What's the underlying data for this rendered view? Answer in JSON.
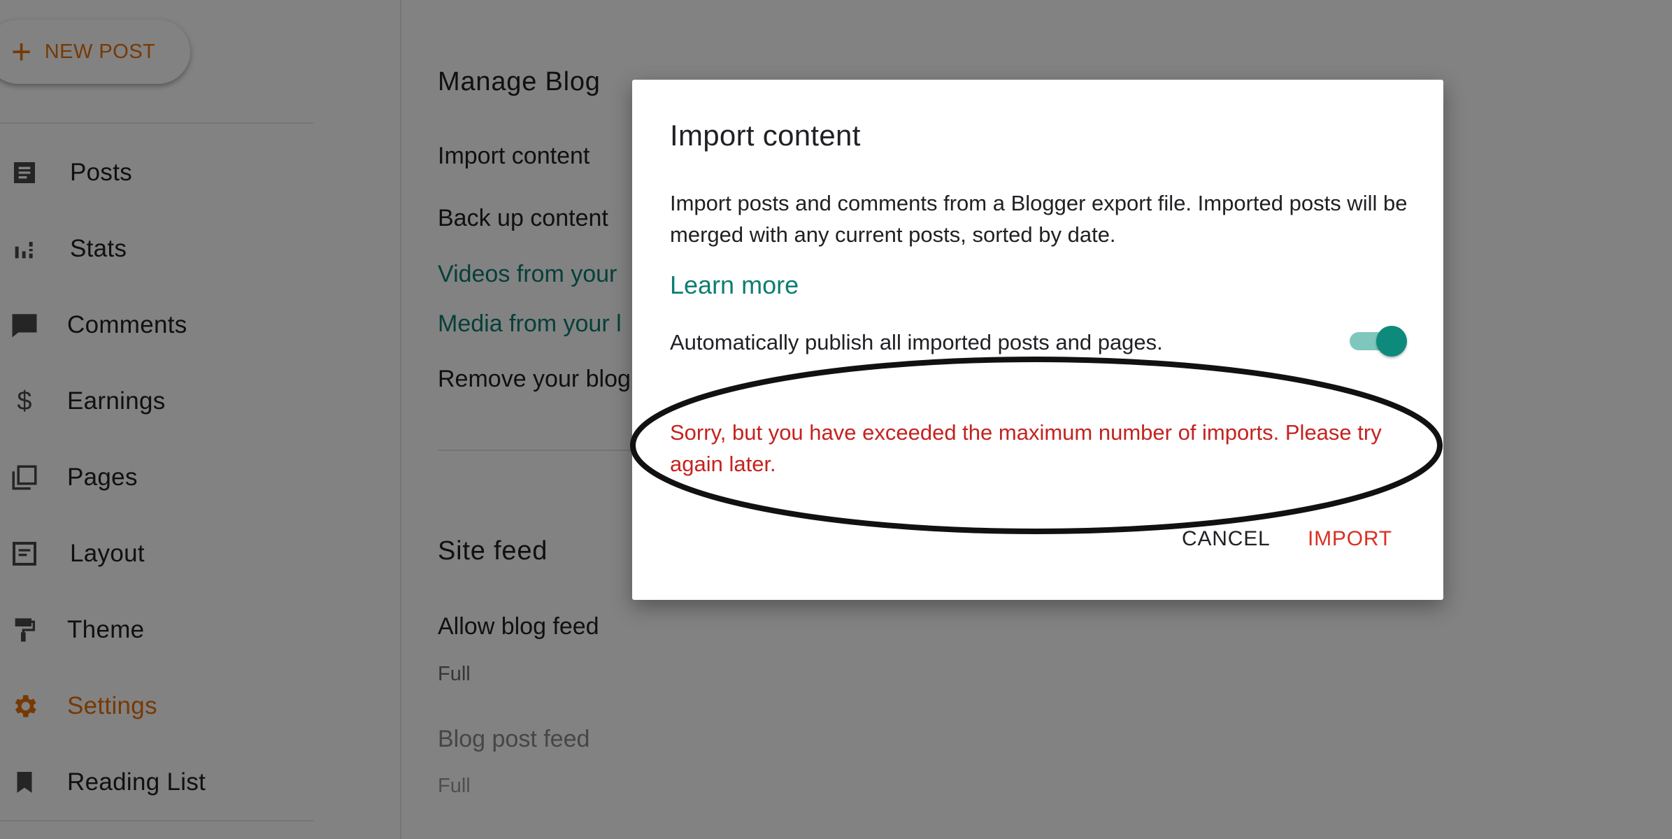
{
  "sidebar": {
    "new_post_label": "NEW POST",
    "items": [
      {
        "label": "Posts",
        "icon": "posts-icon"
      },
      {
        "label": "Stats",
        "icon": "stats-icon"
      },
      {
        "label": "Comments",
        "icon": "comment-icon"
      },
      {
        "label": "Earnings",
        "icon": "dollar-icon"
      },
      {
        "label": "Pages",
        "icon": "pages-icon"
      },
      {
        "label": "Layout",
        "icon": "layout-icon"
      },
      {
        "label": "Theme",
        "icon": "paint-roller-icon"
      },
      {
        "label": "Settings",
        "icon": "gear-icon",
        "active": true
      },
      {
        "label": "Reading List",
        "icon": "bookmark-icon"
      }
    ]
  },
  "main": {
    "manage_blog": {
      "title": "Manage Blog",
      "import_content": "Import content",
      "back_up_content": "Back up content",
      "videos_link": "Videos from your",
      "media_link": "Media from your l",
      "remove_blog": "Remove your blog"
    },
    "site_feed": {
      "title": "Site feed",
      "allow_blog_feed": "Allow blog feed",
      "allow_blog_feed_value": "Full",
      "blog_post_feed": "Blog post feed",
      "blog_post_feed_value": "Full"
    }
  },
  "dialog": {
    "title": "Import content",
    "description": "Import posts and comments from a Blogger export file. Imported posts will be merged with any current posts, sorted by date.",
    "learn_more": "Learn more",
    "toggle_label": "Automatically publish all imported posts and pages.",
    "toggle_on": true,
    "error": "Sorry, but you have exceeded the maximum number of imports. Please try again later.",
    "cancel_label": "CANCEL",
    "import_label": "IMPORT"
  },
  "colors": {
    "accent": "#e8710a",
    "teal": "#0d7d73",
    "error": "#c5221f",
    "scrim": "rgba(0,0,0,0.49)"
  }
}
